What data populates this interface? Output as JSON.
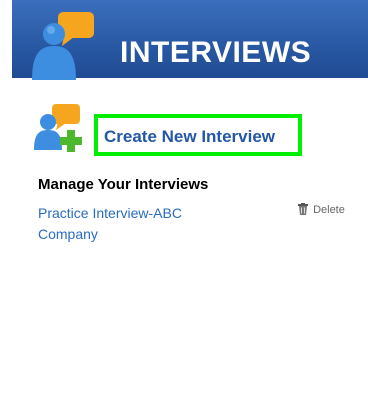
{
  "header": {
    "title": "INTERVIEWS",
    "icon": "interview-people-icon",
    "background_color": "#2a5aa5"
  },
  "create": {
    "icon": "add-interview-icon",
    "label": "Create New Interview",
    "link_color": "#2457a6",
    "highlight_color": "#00ee00"
  },
  "manage": {
    "title": "Manage Your Interviews",
    "items": [
      {
        "name": "Practice Interview-ABC Company",
        "delete_label": "Delete",
        "delete_icon": "trash-icon"
      }
    ]
  }
}
